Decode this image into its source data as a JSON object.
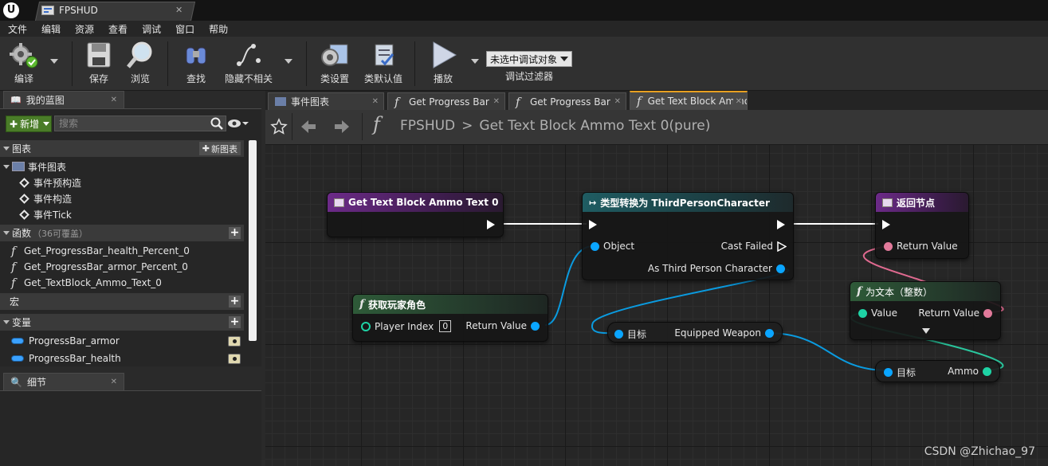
{
  "window": {
    "doc_tab": "FPSHUD",
    "logo": "U"
  },
  "menu": [
    "文件",
    "编辑",
    "资源",
    "查看",
    "调试",
    "窗口",
    "帮助"
  ],
  "toolbar": {
    "compile": "编译",
    "save": "保存",
    "browse": "浏览",
    "find": "查找",
    "hide_unrelated": "隐藏不相关",
    "class_settings": "类设置",
    "class_defaults": "类默认值",
    "play": "播放",
    "debug_select": "未选中调试对象",
    "debug_filter": "调试过滤器"
  },
  "my_blueprint": {
    "tab": "我的蓝图",
    "add_button": "新增",
    "search_placeholder": "搜索",
    "graphs": {
      "label": "图表",
      "add": "新图表"
    },
    "event_graph": "事件图表",
    "events": [
      "事件预构造",
      "事件构造",
      "事件Tick"
    ],
    "functions": {
      "label": "函数",
      "count": "（36可覆盖）"
    },
    "function_items": [
      "Get_ProgressBar_health_Percent_0",
      "Get_ProgressBar_armor_Percent_0",
      "Get_TextBlock_Ammo_Text_0"
    ],
    "macros": "宏",
    "variables": "变量",
    "variable_items": [
      "ProgressBar_armor",
      "ProgressBar_health"
    ]
  },
  "details": {
    "tab": "细节"
  },
  "graph_tabs": [
    "事件图表",
    "Get Progress Bar H",
    "Get Progress Bar A",
    "Get Text Block Ammo"
  ],
  "breadcrumb": {
    "root": "FPSHUD",
    "sep": ">",
    "current": "Get Text Block Ammo Text 0(pure)"
  },
  "nodes": {
    "entry": {
      "title": "Get Text Block Ammo Text 0"
    },
    "cast": {
      "title": "类型转换为 ThirdPersonCharacter",
      "object": "Object",
      "cast_failed": "Cast Failed",
      "as_char": "As Third Person Character"
    },
    "return": {
      "title": "返回节点",
      "return_value": "Return Value"
    },
    "get_player": {
      "title": "获取玩家角色",
      "player_index": "Player Index",
      "player_index_value": "0",
      "return_value": "Return Value"
    },
    "equipped": {
      "target": "目标",
      "output": "Equipped Weapon"
    },
    "ammo": {
      "target": "目标",
      "output": "Ammo"
    },
    "to_text": {
      "title": "为文本（整数）",
      "value": "Value",
      "return_value": "Return Value"
    }
  },
  "colors": {
    "exec": "#ffffff",
    "object_pin": "#0aa5ff",
    "int_pin": "#1ed2a4",
    "text_pin": "#e27a9b",
    "wire_object": "#0a9be0",
    "wire_int": "#2ac79e",
    "wire_text": "#e06a90"
  },
  "watermark": "CSDN @Zhichao_97"
}
